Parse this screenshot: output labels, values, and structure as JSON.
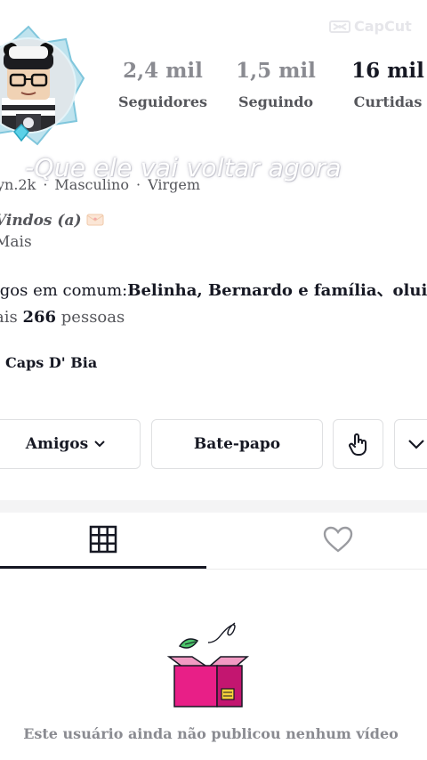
{
  "watermark": {
    "label": "CapCut"
  },
  "stats": [
    {
      "value": "2,4 mil",
      "label": "Seguidores"
    },
    {
      "value": "1,5 mil",
      "label": "Seguindo"
    },
    {
      "value": "16 mil",
      "label": "Curtidas"
    }
  ],
  "caption": "-Que ele vai voltar agora",
  "meta": {
    "handle": "yn.2k",
    "gender": "Masculino",
    "sign": "Virgem"
  },
  "bio": {
    "line1": "Vindos (a)",
    "line2": "Mais"
  },
  "mutual": {
    "prefix": "igos em comum:",
    "names": "Belinha, Bernardo e família、oluizb",
    "line2_prefix": "ais",
    "count": "266",
    "line2_suffix": "pessoas"
  },
  "caps_name": "Caps D' Bia",
  "buttons": {
    "friends": "Amigos",
    "chat": "Bate-papo"
  },
  "empty_state": {
    "text": "Este usuário ainda não publicou nenhum vídeo"
  },
  "colors": {
    "accent": "#ea3e86",
    "text": "#161823",
    "muted": "#55565b"
  }
}
